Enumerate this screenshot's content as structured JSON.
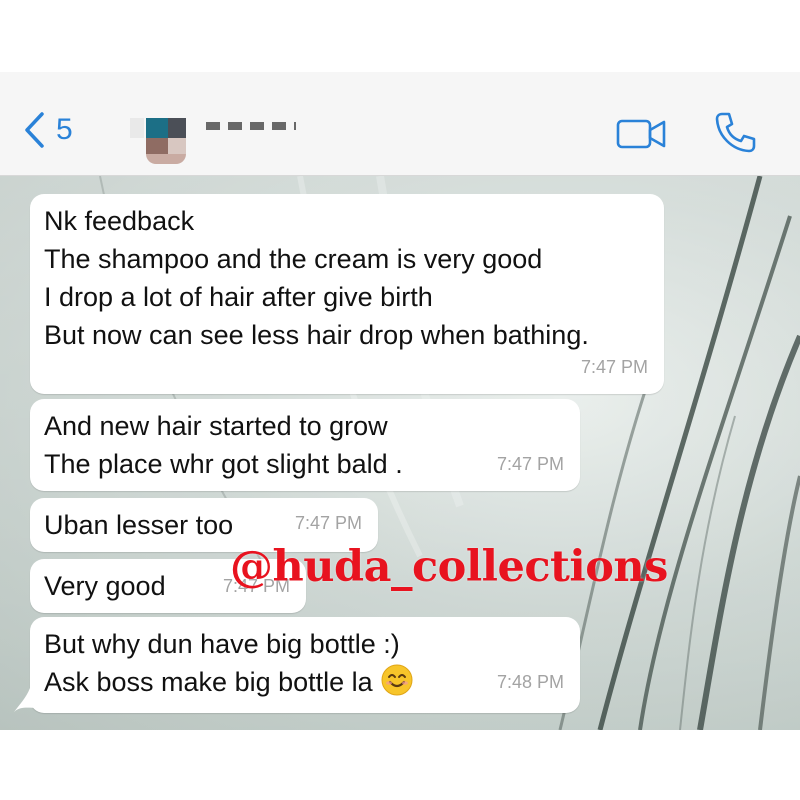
{
  "header": {
    "back_count": "5",
    "video_icon": "video-camera-icon",
    "phone_icon": "phone-icon",
    "accent": "#2a82d8"
  },
  "messages": [
    {
      "lines": [
        "Nk feedback",
        "The shampoo and the cream is very good",
        "I drop a lot of hair after give birth",
        "But now can see less hair drop when bathing."
      ],
      "time": "7:47 PM"
    },
    {
      "lines": [
        "And new hair started to grow",
        "The place whr got slight bald ."
      ],
      "time": "7:47 PM"
    },
    {
      "lines": [
        "Uban lesser too"
      ],
      "time": "7:47 PM"
    },
    {
      "lines": [
        "Very good"
      ],
      "time": "7:47 PM"
    },
    {
      "lines": [
        "But why dun have big bottle :)",
        "Ask boss make big bottle la"
      ],
      "emoji": "smiling-face-emoji",
      "time": "7:48 PM"
    }
  ],
  "watermark": "@huda_collections",
  "colors": {
    "bubble": "#ffffff",
    "watermark": "#e8131f",
    "timestamp": "#a3a3a3"
  }
}
